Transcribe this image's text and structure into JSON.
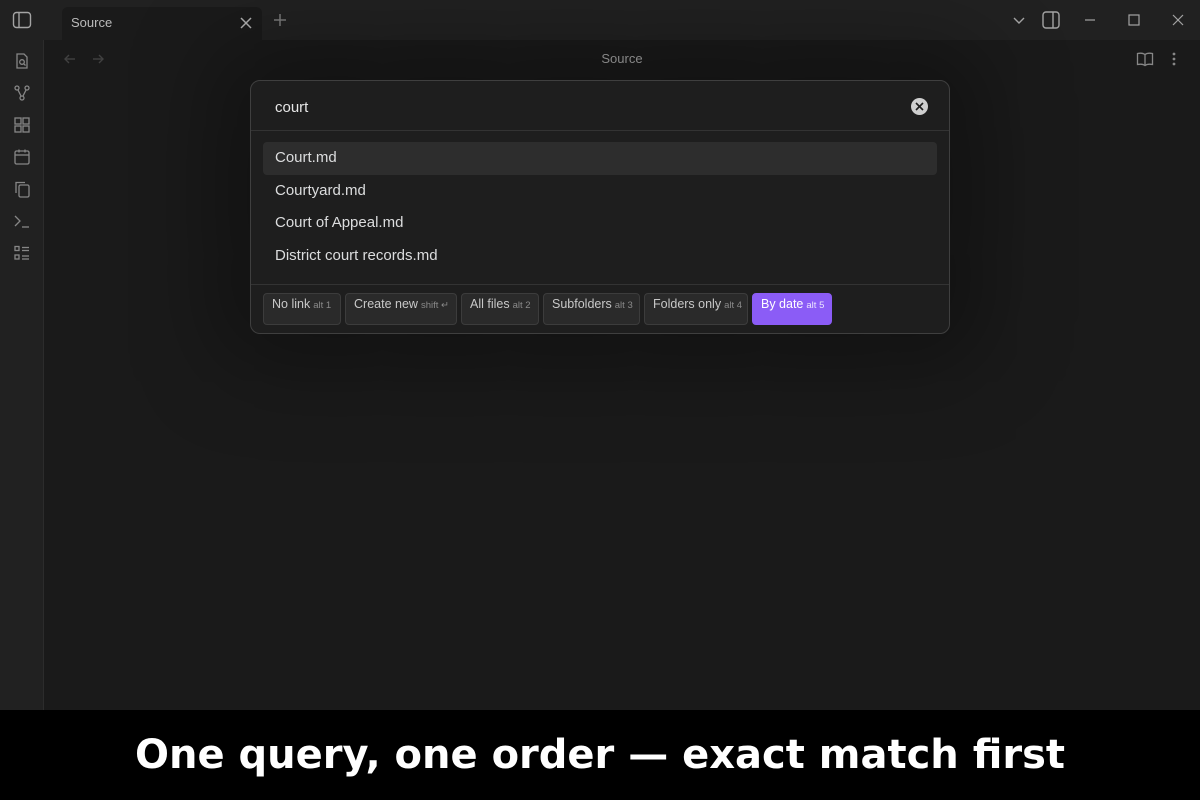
{
  "tab": {
    "title": "Source"
  },
  "header": {
    "title": "Source"
  },
  "search": {
    "query": "court",
    "placeholder": ""
  },
  "results": [
    "Court.md",
    "Courtyard.md",
    "Court of Appeal.md",
    "District court records.md"
  ],
  "options": [
    {
      "label": "No link",
      "hint": "alt 1",
      "active": false
    },
    {
      "label": "Create new",
      "hint": "shift ↵",
      "active": false
    },
    {
      "label": "All files",
      "hint": "alt 2",
      "active": false
    },
    {
      "label": "Subfolders",
      "hint": "alt 3",
      "active": false
    },
    {
      "label": "Folders only",
      "hint": "alt 4",
      "active": false
    },
    {
      "label": "By date",
      "hint": "alt 5",
      "active": true
    }
  ],
  "caption": {
    "text": "One query, one order — exact match first"
  },
  "colors": {
    "accent": "#8b5cf6",
    "background": "#1e1e1e",
    "chrome": "#262626"
  },
  "icons": [
    "sidebar-toggle-icon",
    "close-icon",
    "plus-icon",
    "chevron-down-icon",
    "right-sidebar-icon",
    "minimize-icon",
    "maximize-icon",
    "file-search-icon",
    "graph-icon",
    "grid-icon",
    "calendar-icon",
    "copy-icon",
    "terminal-icon",
    "list-icon",
    "arrow-left-icon",
    "arrow-right-icon",
    "book-open-icon",
    "more-vertical-icon"
  ]
}
